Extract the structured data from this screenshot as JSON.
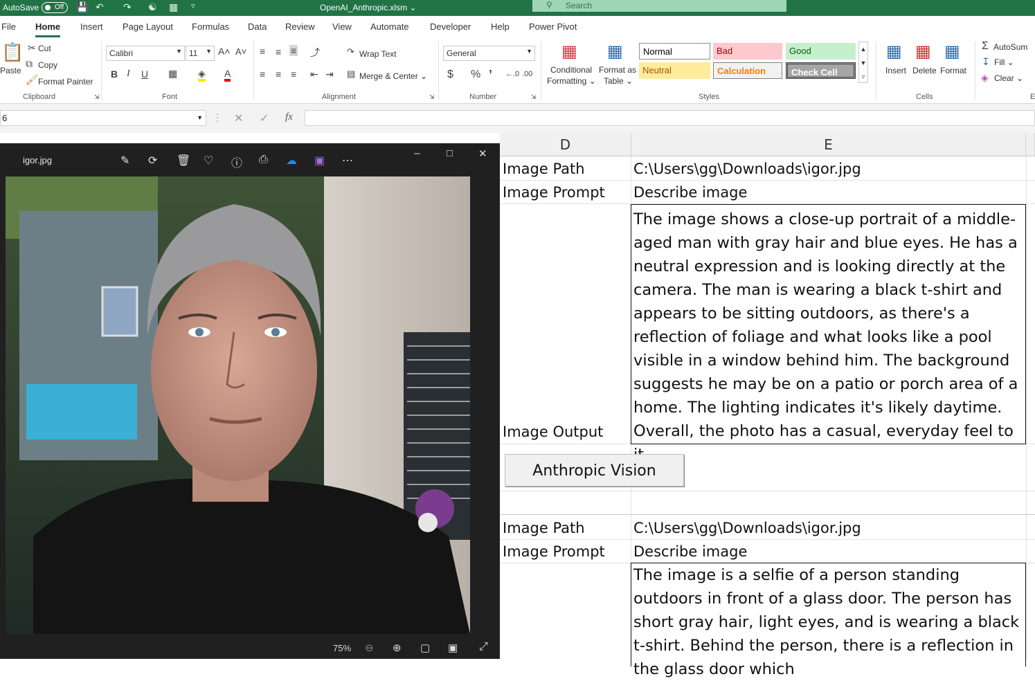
{
  "titlebar": {
    "autosave_label": "AutoSave",
    "autosave_state": "Off",
    "filename": "OpenAI_Anthropic.xlsm",
    "search_placeholder": "Search"
  },
  "menu": {
    "items": [
      "File",
      "Home",
      "Insert",
      "Page Layout",
      "Formulas",
      "Data",
      "Review",
      "View",
      "Automate",
      "Developer",
      "Help",
      "Power Pivot"
    ]
  },
  "ribbon": {
    "clipboard": {
      "paste": "Paste",
      "cut": "Cut",
      "copy": "Copy",
      "format_painter": "Format Painter",
      "label": "Clipboard"
    },
    "font": {
      "name": "Calibri",
      "size": "11",
      "label": "Font"
    },
    "alignment": {
      "wrap_text": "Wrap Text",
      "merge_center": "Merge & Center",
      "label": "Alignment"
    },
    "number": {
      "format": "General",
      "label": "Number"
    },
    "styles": {
      "conditional": "Conditional",
      "formatting": "Formatting",
      "format_as": "Format as",
      "table": "Table",
      "normal": "Normal",
      "bad": "Bad",
      "good": "Good",
      "neutral": "Neutral",
      "calculation": "Calculation",
      "check_cell": "Check Cell",
      "label": "Styles"
    },
    "cells": {
      "insert": "Insert",
      "delete": "Delete",
      "format": "Format",
      "label": "Cells"
    },
    "editing": {
      "autosum": "AutoSum",
      "fill": "Fill",
      "clear": "Clear",
      "label": "E"
    }
  },
  "formulabar": {
    "namebox": "6",
    "fx": "fx"
  },
  "photos": {
    "filename": "igor.jpg",
    "zoom": "75%"
  },
  "sheet": {
    "col_d": "D",
    "col_e": "E",
    "block1": {
      "path_label": "Image Path",
      "path_value": "C:\\Users\\gg\\Downloads\\igor.jpg",
      "prompt_label": "Image Prompt",
      "prompt_value": "Describe image",
      "output_label": "Image Output",
      "output_text": "The image shows a close-up portrait of a middle-aged man with gray hair and blue eyes. He has a neutral expression and is looking directly at the camera. The man is wearing a black t-shirt and appears to be sitting outdoors, as there's a reflection of foliage and what looks like a pool visible in a window behind him. The background suggests he may be on a patio or porch area of a home. The lighting indicates it's likely daytime. Overall, the photo has a casual, everyday feel to it."
    },
    "button": "Anthropic Vision",
    "block2": {
      "path_label": "Image Path",
      "path_value": "C:\\Users\\gg\\Downloads\\igor.jpg",
      "prompt_label": "Image Prompt",
      "prompt_value": "Describe image",
      "output_text": "The image is a selfie of a person standing outdoors in front of a glass door. The person has short gray hair, light eyes, and is wearing a black t-shirt. Behind the person, there is a reflection in the glass door which"
    }
  },
  "colors": {
    "excel_green": "#217346",
    "bad_bg": "#ffc7ce",
    "good_bg": "#c6efce",
    "neutral_bg": "#ffeb9c",
    "check_bg": "#a5a5a5"
  }
}
